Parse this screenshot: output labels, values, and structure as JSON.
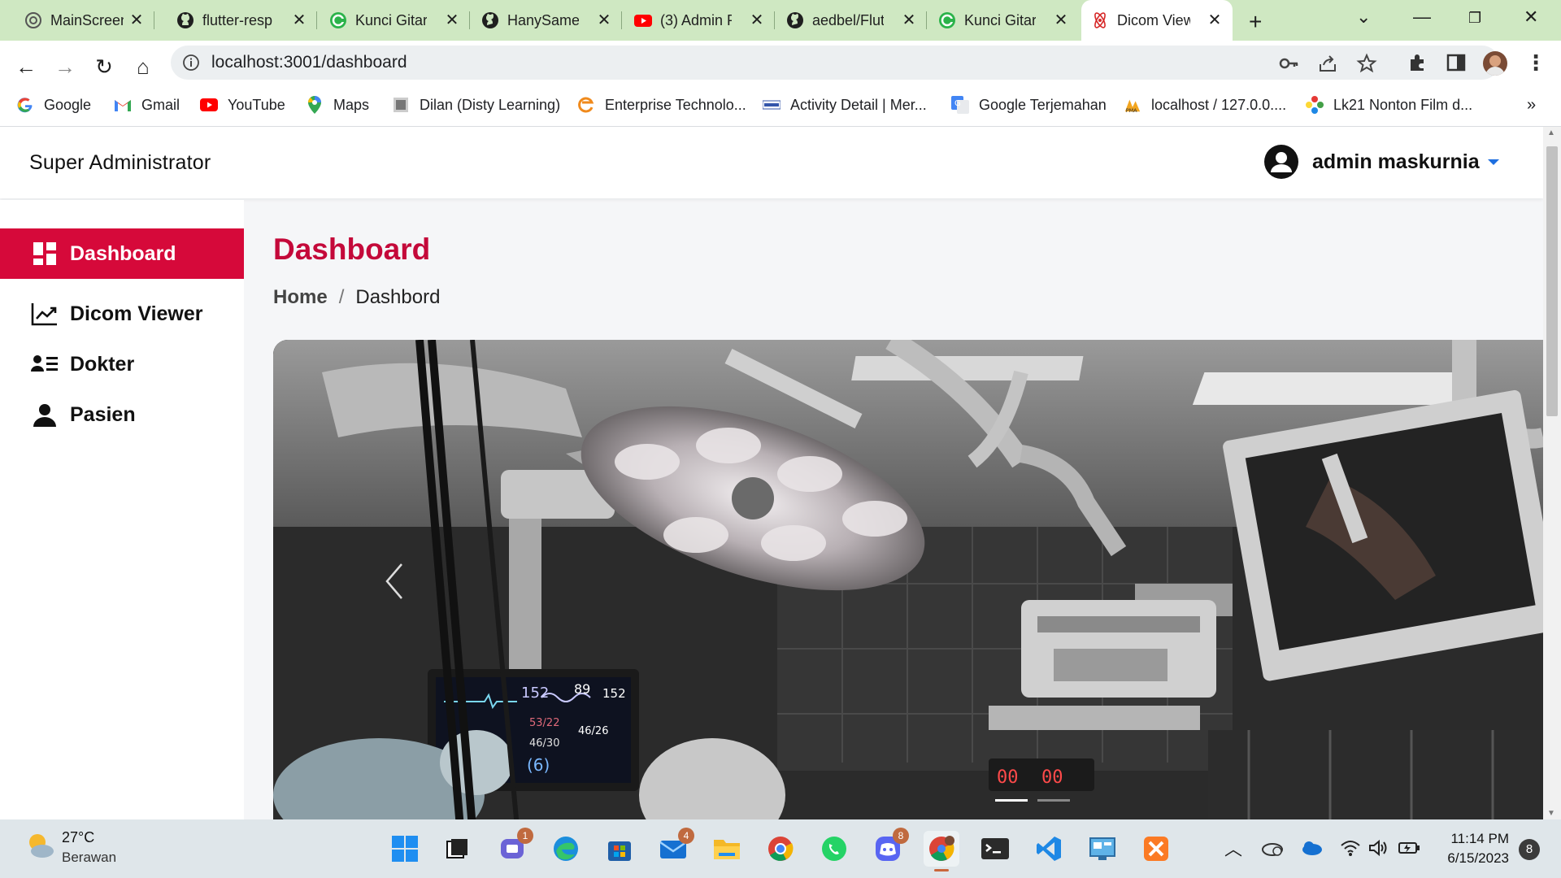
{
  "browser": {
    "tabs": [
      {
        "title": "MainScreen",
        "icon": "chatgpt-icon"
      },
      {
        "title": "flutter-resp",
        "icon": "github-icon"
      },
      {
        "title": "Kunci Gitar",
        "icon": "chordtela-icon"
      },
      {
        "title": "HanySameh",
        "icon": "github-icon"
      },
      {
        "title": "(3) Admin P",
        "icon": "youtube-icon"
      },
      {
        "title": "aedbel/Flut",
        "icon": "github-icon"
      },
      {
        "title": "Kunci Gitar",
        "icon": "chordtela-icon"
      },
      {
        "title": "Dicom View",
        "icon": "react-icon"
      }
    ],
    "url": "localhost:3001/dashboard",
    "bookmarks": [
      {
        "label": "Google",
        "icon": "google-icon"
      },
      {
        "label": "Gmail",
        "icon": "gmail-icon"
      },
      {
        "label": "YouTube",
        "icon": "youtube-icon"
      },
      {
        "label": "Maps",
        "icon": "maps-icon"
      },
      {
        "label": "Dilan (Disty Learning)",
        "icon": "dilan-icon"
      },
      {
        "label": "Enterprise Technolo...",
        "icon": "enterprise-icon"
      },
      {
        "label": "Activity Detail | Mer...",
        "icon": "activity-icon"
      },
      {
        "label": "Google Terjemahan",
        "icon": "translate-icon"
      },
      {
        "label": "localhost / 127.0.0....",
        "icon": "phpmyadmin-icon"
      },
      {
        "label": "Lk21 Nonton Film d...",
        "icon": "lk21-icon"
      }
    ],
    "more_bookmarks": "»"
  },
  "app": {
    "brand": "Super Administrator",
    "user": "admin maskurnia",
    "sidebar": [
      {
        "label": "Dashboard",
        "icon": "dashboard-grid-icon",
        "active": true
      },
      {
        "label": "Dicom Viewer",
        "icon": "line-chart-icon",
        "active": false
      },
      {
        "label": "Dokter",
        "icon": "user-list-icon",
        "active": false
      },
      {
        "label": "Pasien",
        "icon": "user-icon",
        "active": false
      }
    ],
    "page_title": "Dashboard",
    "breadcrumb": {
      "home": "Home",
      "separator": "/",
      "current": "Dashbord"
    },
    "carousel_readouts": [
      "152",
      "89",
      "152",
      "53/22",
      "46/26",
      "46/30",
      "(6)",
      "00",
      "00"
    ]
  },
  "taskbar": {
    "weather_temp": "27°C",
    "weather_desc": "Berawan",
    "badges": {
      "teams": "1",
      "mail": "4",
      "discord": "8"
    },
    "time": "11:14 PM",
    "date": "6/15/2023",
    "notifications": "8"
  },
  "colors": {
    "accent": "#d6093a",
    "title": "#c4093a",
    "tab_strip": "#cfe8c2"
  }
}
